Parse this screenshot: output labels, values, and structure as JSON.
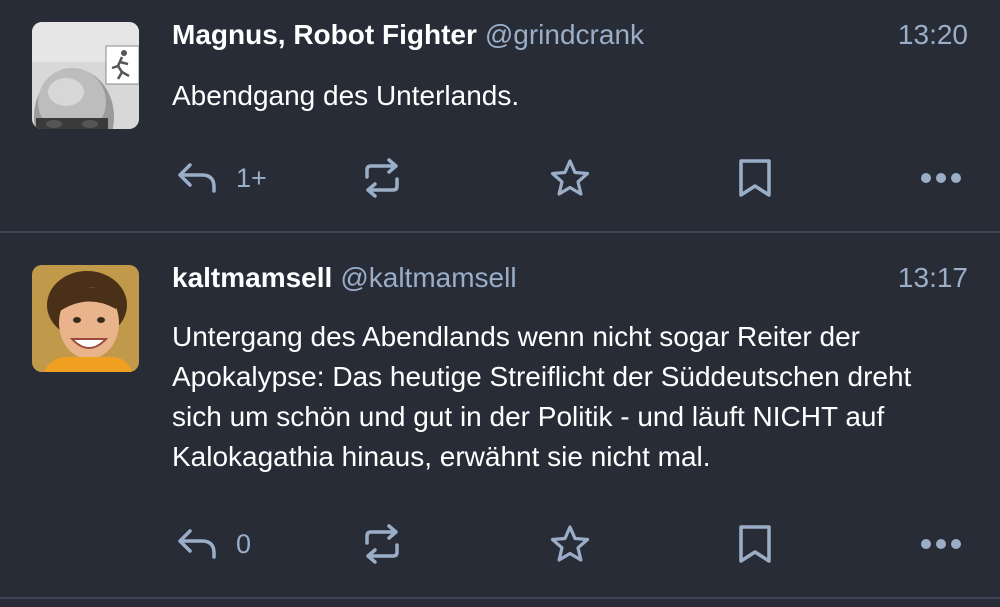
{
  "theme": {
    "background": "#282c37",
    "text": "#ffffff",
    "muted": "#9baec8",
    "divider": "#3f4556"
  },
  "statuses": [
    {
      "display_name": "Magnus, Robot Fighter",
      "handle": "@grindcrank",
      "time": "13:20",
      "content": "Abendgang des Unterlands.",
      "reply_count": "1+",
      "avatar": "bald-man-with-exit-sign"
    },
    {
      "display_name": "kaltmamsell",
      "handle": "@kaltmamsell",
      "time": "13:17",
      "content": "Untergang des Abendlands wenn nicht sogar Reiter der Apokalypse: Das heutige Streiflicht der Süddeutschen dreht sich um schön und gut in der Politik - und läuft NICHT auf Kalokagathia hinaus, erwähnt sie nicht mal.",
      "reply_count": "0",
      "avatar": "smiling-child-photo"
    }
  ],
  "icons": {
    "reply": "reply-icon",
    "boost": "boost-icon",
    "favourite": "star-icon",
    "bookmark": "bookmark-icon",
    "more": "more-icon"
  }
}
